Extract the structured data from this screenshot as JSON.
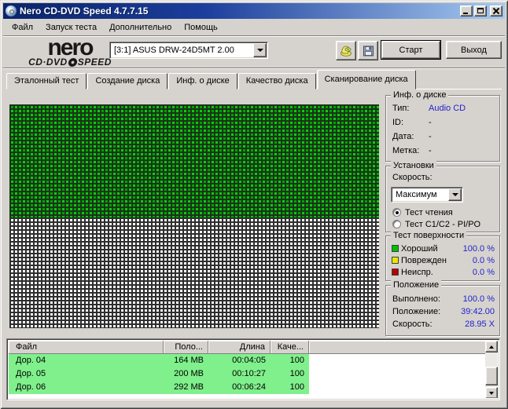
{
  "window": {
    "title": "Nero CD-DVD Speed 4.7.7.15"
  },
  "icons": {
    "app": "cd-disc-icon",
    "toolbar_first": "hand-with-discs-icon",
    "toolbar_second": "save-floppy-icon",
    "window_controls": [
      "minimize-icon",
      "maximize-icon",
      "close-icon"
    ]
  },
  "menu": {
    "items": [
      "Файл",
      "Запуск теста",
      "Дополнительно",
      "Помощь"
    ]
  },
  "toolbar": {
    "logo": {
      "line1": "nero",
      "line2_left": "CD·DVD",
      "line2_right": "SPEED"
    },
    "drive_select": {
      "value": "[3:1]   ASUS DRW-24D5MT 2.00"
    },
    "start_label": "Старт",
    "exit_label": "Выход"
  },
  "tabs": {
    "items": [
      "Эталонный тест",
      "Создание диска",
      "Инф. о диске",
      "Качество диска",
      "Сканирование диска"
    ],
    "active_index": 4
  },
  "disc_info": {
    "title": "Инф. о диске",
    "rows": [
      {
        "label": "Тип:",
        "value": "Audio CD"
      },
      {
        "label": "ID:",
        "value": "-"
      },
      {
        "label": "Дата:",
        "value": "-"
      },
      {
        "label": "Метка:",
        "value": "-"
      }
    ]
  },
  "settings": {
    "title": "Установки",
    "speed_label": "Скорость:",
    "speed_value": "Максимум",
    "radio_read": "Тест чтения",
    "radio_c1c2": "Тест C1/C2 - PI/PO",
    "selected_radio": "Тест чтения"
  },
  "surface": {
    "title": "Тест поверхности",
    "rows": [
      {
        "label": "Хороший",
        "value": "100.0 %",
        "color": "#00c000"
      },
      {
        "label": "Поврежден",
        "value": "0.0 %",
        "color": "#e8e800"
      },
      {
        "label": "Неиспр.",
        "value": "0.0 %",
        "color": "#b40000"
      }
    ]
  },
  "position": {
    "title": "Положение",
    "rows": [
      {
        "label": "Выполнено:",
        "value": "100.0 %"
      },
      {
        "label": "Положение:",
        "value": "39:42.00"
      },
      {
        "label": "Скорость:",
        "value": "28.95 X"
      }
    ]
  },
  "tracks": {
    "columns": [
      "Файл",
      "Поло...",
      "Длина",
      "Каче..."
    ],
    "rows": [
      [
        "Дор. 04",
        "164 MB",
        "00:04:05",
        "100"
      ],
      [
        "Дор. 05",
        "200 MB",
        "00:10:27",
        "100"
      ],
      [
        "Дор. 06",
        "292 MB",
        "00:06:24",
        "100"
      ]
    ]
  },
  "scan_grid": {
    "scanned_percent": 50.5,
    "good_color": "#00b400",
    "good_alt_color": "#06d206",
    "grid_line_color": "#1c321c",
    "unscanned_color": "#ffffff"
  },
  "colors": {
    "value_blue": "#2222cc",
    "track_row_green": "#80f08c",
    "titlebar_from": "#0a246a",
    "titlebar_to": "#a6caf0",
    "window_bg": "#d6d3ce"
  }
}
